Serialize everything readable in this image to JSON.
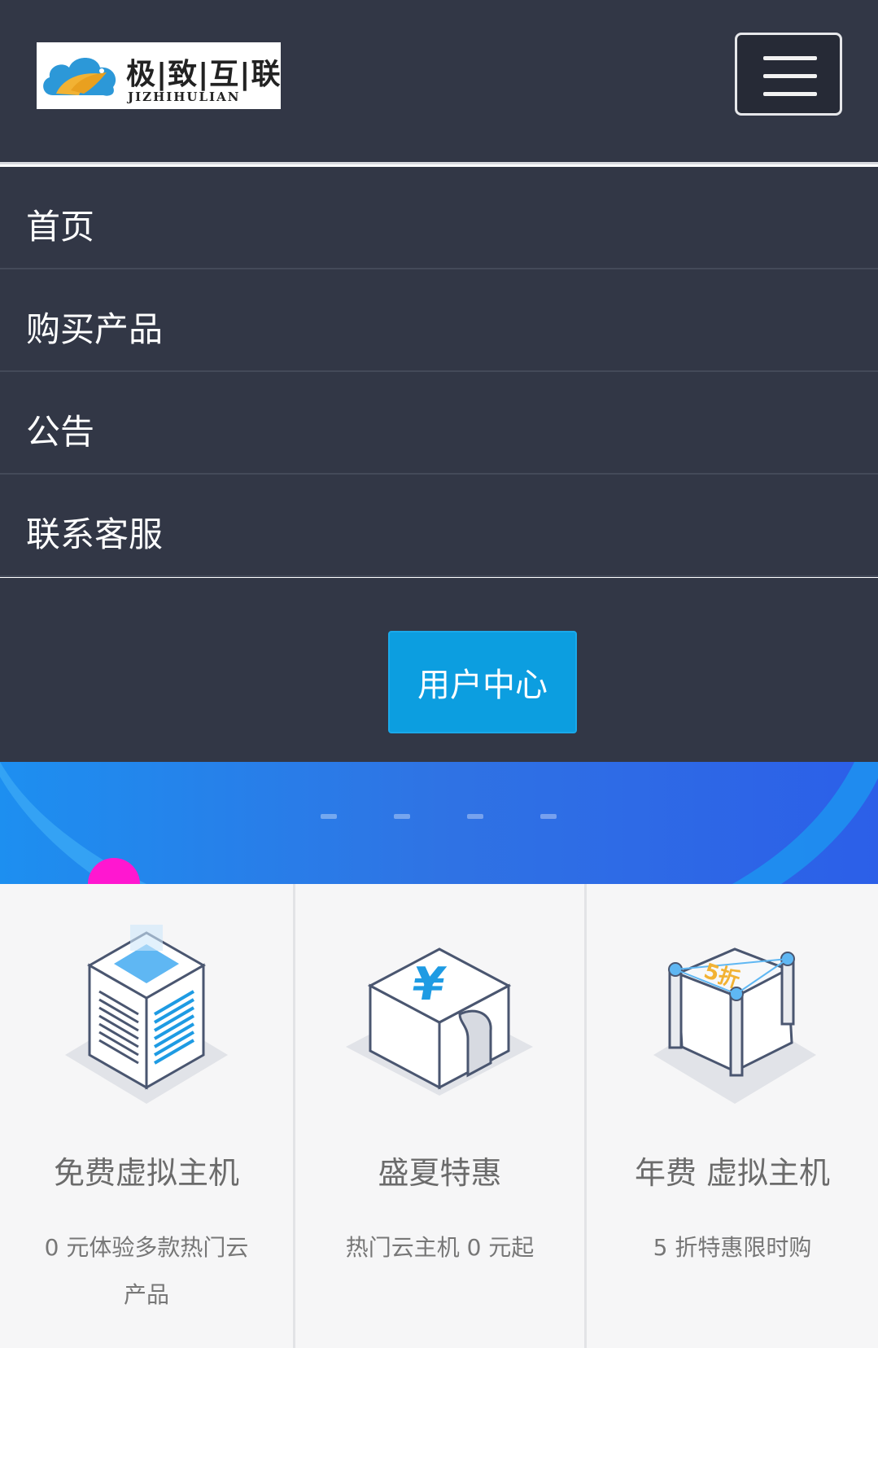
{
  "header": {
    "logo": {
      "cn": "极|致|互|联",
      "en": "JIZHIHULIAN"
    },
    "menu_toggle_icon": "hamburger-icon"
  },
  "nav": {
    "items": [
      {
        "label": "首页"
      },
      {
        "label": "购买产品"
      },
      {
        "label": "公告"
      },
      {
        "label": "联系客服"
      }
    ],
    "user_center_label": "用户中心"
  },
  "banner": {
    "slides": 4
  },
  "features": [
    {
      "title": "免费虚拟主机",
      "desc": "0 元体验多款热门云产品",
      "icon": "server-building-icon"
    },
    {
      "title": "盛夏特惠",
      "desc": "热门云主机 0 元起",
      "icon": "yuan-puzzle-icon"
    },
    {
      "title": "年费 虚拟主机",
      "desc": "5 折特惠限时购",
      "icon": "discount-box-icon",
      "badge": "5折"
    }
  ],
  "colors": {
    "header_bg": "#323746",
    "accent": "#0c9ee0",
    "banner_start": "#1d8ff0",
    "banner_end": "#2c5fe8"
  }
}
